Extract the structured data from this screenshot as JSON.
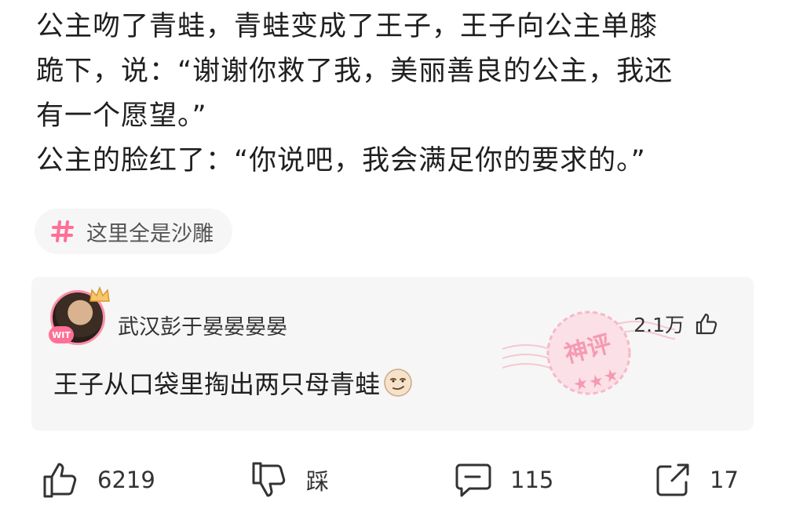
{
  "story": {
    "lines": [
      "公主吻了青蛙，青蛙变成了王子，王子向公主单膝",
      "跪下，说：“谢谢你救了我，美丽善良的公主，我还",
      "有一个愿望。”",
      "公主的脸红了：“你说吧，我会满足你的要求的。”"
    ]
  },
  "tag": {
    "label": "这里全是沙雕",
    "icon": "hash-icon",
    "color": "#ff6f96"
  },
  "top_comment": {
    "username": "武汉彭于晏晏晏晏",
    "like_count": "2.1万",
    "text": "王子从口袋里掏出两只母青蛙",
    "stamp_label": "神评",
    "avatar_badge": "WIT"
  },
  "actions": {
    "like_count": "6219",
    "dislike_label": "踩",
    "comment_count": "115",
    "share_count": "17"
  }
}
